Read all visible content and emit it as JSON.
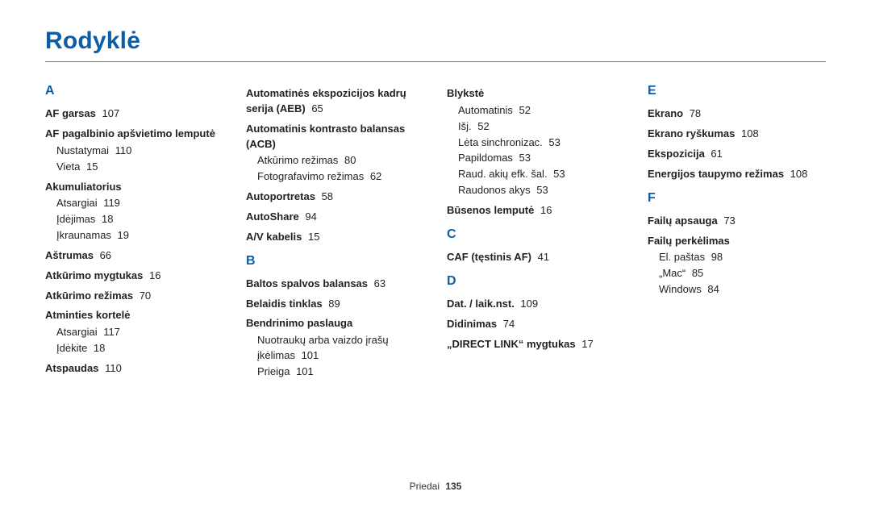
{
  "title": "Rodyklė",
  "footer": {
    "section": "Priedai",
    "page": "135"
  },
  "columns": [
    [
      {
        "type": "letter",
        "text": "A"
      },
      {
        "type": "entry",
        "label": "AF garsas",
        "page": "107"
      },
      {
        "type": "entry",
        "label": "AF pagalbinio apšvietimo lemputė",
        "subs": [
          {
            "label": "Nustatymai",
            "page": "110"
          },
          {
            "label": "Vieta",
            "page": "15"
          }
        ]
      },
      {
        "type": "entry",
        "label": "Akumuliatorius",
        "subs": [
          {
            "label": "Atsargiai",
            "page": "119"
          },
          {
            "label": "Įdėjimas",
            "page": "18"
          },
          {
            "label": "Įkraunamas",
            "page": "19"
          }
        ]
      },
      {
        "type": "entry",
        "label": "Aštrumas",
        "page": "66"
      },
      {
        "type": "entry",
        "label": "Atkūrimo mygtukas",
        "page": "16"
      },
      {
        "type": "entry",
        "label": "Atkūrimo režimas",
        "page": "70"
      },
      {
        "type": "entry",
        "label": "Atminties kortelė",
        "subs": [
          {
            "label": "Atsargiai",
            "page": "117"
          },
          {
            "label": "Įdėkite",
            "page": "18"
          }
        ]
      },
      {
        "type": "entry",
        "label": "Atspaudas",
        "page": "110"
      }
    ],
    [
      {
        "type": "entry",
        "label": "Automatinės ekspozicijos kadrų serija (AEB)",
        "page": "65"
      },
      {
        "type": "entry",
        "label": "Automatinis kontrasto balansas (ACB)",
        "subs": [
          {
            "label": "Atkūrimo režimas",
            "page": "80"
          },
          {
            "label": "Fotografavimo režimas",
            "page": "62"
          }
        ]
      },
      {
        "type": "entry",
        "label": "Autoportretas",
        "page": "58"
      },
      {
        "type": "entry",
        "label": "AutoShare",
        "page": "94"
      },
      {
        "type": "entry",
        "label": "A/V kabelis",
        "page": "15"
      },
      {
        "type": "letter",
        "text": "B"
      },
      {
        "type": "entry",
        "label": "Baltos spalvos balansas",
        "page": "63"
      },
      {
        "type": "entry",
        "label": "Belaidis tinklas",
        "page": "89"
      },
      {
        "type": "entry",
        "label": "Bendrinimo paslauga",
        "subs": [
          {
            "label": "Nuotraukų arba vaizdo įrašų įkėlimas",
            "page": "101"
          },
          {
            "label": "Prieiga",
            "page": "101"
          }
        ]
      }
    ],
    [
      {
        "type": "entry",
        "label": "Blykstė",
        "subs": [
          {
            "label": "Automatinis",
            "page": "52"
          },
          {
            "label": "Išj.",
            "page": "52"
          },
          {
            "label": "Lėta sinchronizac.",
            "page": "53"
          },
          {
            "label": "Papildomas",
            "page": "53"
          },
          {
            "label": "Raud. akių efk. šal.",
            "page": "53"
          },
          {
            "label": "Raudonos akys",
            "page": "53"
          }
        ]
      },
      {
        "type": "entry",
        "label": "Būsenos lemputė",
        "page": "16"
      },
      {
        "type": "letter",
        "text": "C"
      },
      {
        "type": "entry",
        "label": "CAF (tęstinis AF)",
        "page": "41"
      },
      {
        "type": "letter",
        "text": "D"
      },
      {
        "type": "entry",
        "label": "Dat. / laik.nst.",
        "page": "109"
      },
      {
        "type": "entry",
        "label": "Didinimas",
        "page": "74"
      },
      {
        "type": "entry",
        "label": "„DIRECT LINK“ mygtukas",
        "page": "17"
      }
    ],
    [
      {
        "type": "letter",
        "text": "E"
      },
      {
        "type": "entry",
        "label": "Ekrano",
        "page": "78"
      },
      {
        "type": "entry",
        "label": "Ekrano ryškumas",
        "page": "108"
      },
      {
        "type": "entry",
        "label": "Ekspozicija",
        "page": "61"
      },
      {
        "type": "entry",
        "label": "Energijos taupymo režimas",
        "page": "108"
      },
      {
        "type": "letter",
        "text": "F"
      },
      {
        "type": "entry",
        "label": "Failų apsauga",
        "page": "73"
      },
      {
        "type": "entry",
        "label": "Failų perkėlimas",
        "subs": [
          {
            "label": "El. paštas",
            "page": "98"
          },
          {
            "label": "„Mac“",
            "page": "85"
          },
          {
            "label": "Windows",
            "page": "84"
          }
        ]
      }
    ]
  ]
}
